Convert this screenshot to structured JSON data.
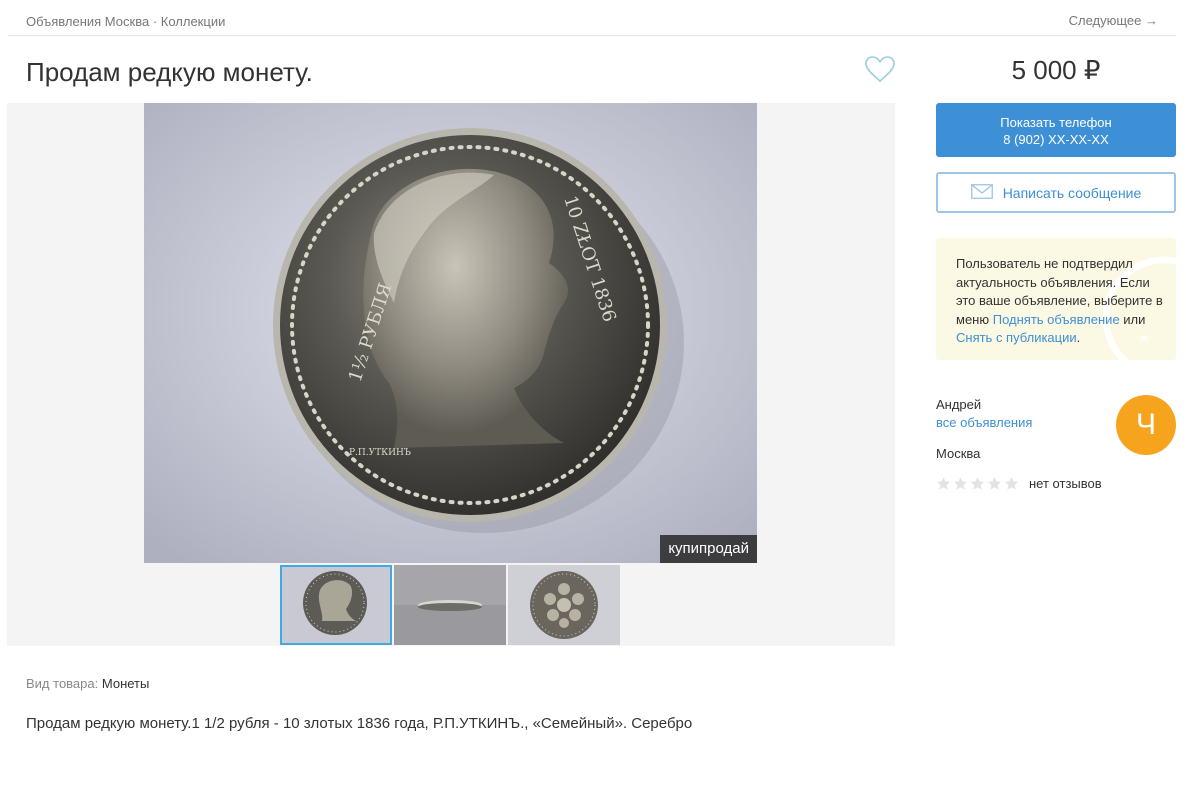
{
  "breadcrumb": {
    "items": [
      "Объявления Москва",
      "Коллекции"
    ],
    "separator": " · "
  },
  "nav": {
    "next_label": "Следующее →"
  },
  "listing": {
    "title": "Продам редкую монету.",
    "photo_watermark": "купипродай",
    "meta_label": "Вид товара:",
    "meta_value": "Монеты",
    "description": "Продам редкую монету.1 1/2 рубля - 10 злотых 1836 года, Р.П.УТКИНЪ., «Семейный». Серебро",
    "coin_legend_left": "1½ РУБЛЯ",
    "coin_legend_right": "10 ZŁOT 1836",
    "coin_signature": "Р.П.УТКИНЪ"
  },
  "sidebar": {
    "price": "5 000 ₽",
    "phone_button_label": "Показать телефон",
    "phone_number": "8 (902) XX-XX-XX",
    "message_button_label": "Написать сообщение",
    "notice": {
      "text_1": "Пользователь не подтвердил актуальность объявления. Если это ваше объявление, выберите в меню",
      "link_1": "Поднять объявление",
      "text_2": "или",
      "link_2": "Снять с публикации",
      "text_3": "."
    },
    "seller": {
      "name": "Андрей",
      "all_ads_link": "все объявления",
      "avatar_letter": "Ч",
      "city": "Москва",
      "rating": 0,
      "rating_max": 5,
      "reviews_label": "нет отзывов"
    }
  },
  "colors": {
    "accent": "#3d8fd6",
    "notice_bg": "#fbf8e4",
    "avatar_bg": "#f6a41e",
    "active_thumb": "#40a9e0"
  },
  "icons": {
    "favorite": "heart-outline-icon",
    "message": "envelope-icon",
    "rating": "star-icon"
  }
}
